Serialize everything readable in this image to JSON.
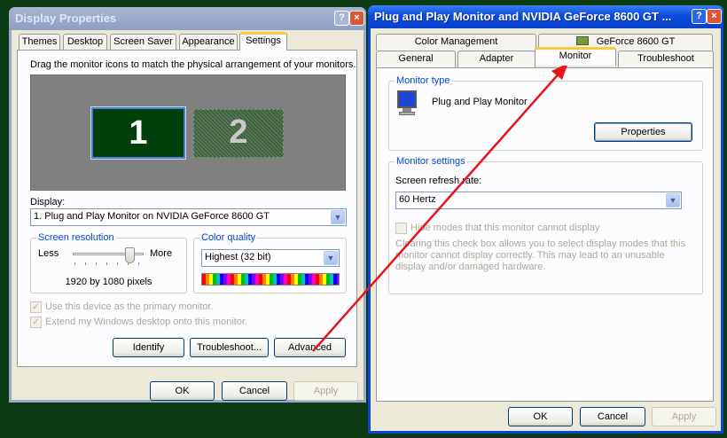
{
  "display_properties": {
    "title": "Display Properties",
    "tabs": [
      "Themes",
      "Desktop",
      "Screen Saver",
      "Appearance",
      "Settings"
    ],
    "instruction": "Drag the monitor icons to match the physical arrangement of your monitors.",
    "monitors": [
      "1",
      "2"
    ],
    "display_label": "Display:",
    "display_value": "1. Plug and Play Monitor on NVIDIA GeForce 8600 GT",
    "resolution_group": "Screen resolution",
    "less_label": "Less",
    "more_label": "More",
    "resolution_value": "1920 by 1080 pixels",
    "color_group": "Color quality",
    "color_value": "Highest (32 bit)",
    "primary_checkbox": "Use this device as the primary monitor.",
    "extend_checkbox": "Extend my Windows desktop onto this monitor.",
    "identify_button": "Identify",
    "troubleshoot_button": "Troubleshoot...",
    "advanced_button": "Advanced",
    "ok_button": "OK",
    "cancel_button": "Cancel",
    "apply_button": "Apply",
    "help_glyph": "?",
    "close_glyph": "×"
  },
  "monitor_dialog": {
    "title": "Plug and Play Monitor and NVIDIA GeForce 8600 GT ...",
    "tabs_top": [
      "Color Management",
      "GeForce 8600 GT"
    ],
    "tabs_bottom": [
      "General",
      "Adapter",
      "Monitor",
      "Troubleshoot"
    ],
    "monitor_type_group": "Monitor type",
    "monitor_name": "Plug and Play Monitor",
    "properties_button": "Properties",
    "monitor_settings_group": "Monitor settings",
    "refresh_label": "Screen refresh rate:",
    "refresh_value": "60 Hertz",
    "hide_modes_checkbox": "Hide modes that this monitor cannot display",
    "hide_modes_note": "Clearing this check box allows you to select display modes that this monitor cannot display correctly. This may lead to an unusable display and/or damaged hardware.",
    "ok_button": "OK",
    "cancel_button": "Cancel",
    "apply_button": "Apply",
    "help_glyph": "?",
    "close_glyph": "×"
  },
  "colors": {
    "desktop_background": "#0b3b12",
    "annotation_arrow": "#e8141c",
    "xp_accent": "#0a46d8",
    "tab_highlight": "#ffc83c"
  }
}
